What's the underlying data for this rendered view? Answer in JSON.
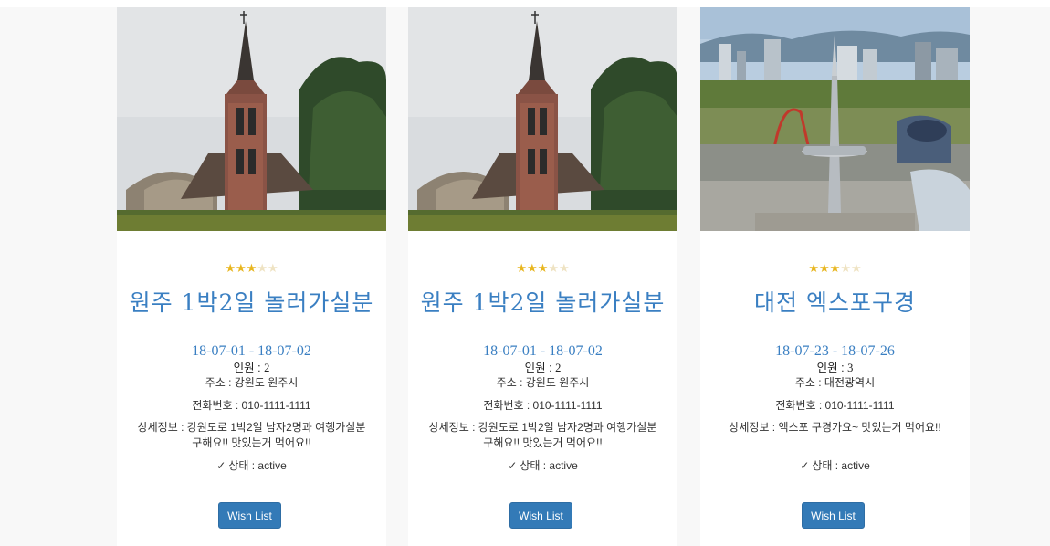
{
  "cards": [
    {
      "image": "church-photo",
      "rating": 3,
      "max_rating": 5,
      "title": "원주 1박2일 놀러가실분",
      "dates": "18-07-01 - 18-07-02",
      "people_label": "인원 : ",
      "people_value": "2",
      "address": "주소 :  강원도 원주시",
      "phone": "전화번호 :  010-1111-1111",
      "detail": "상세정보 :  강원도로 1박2일 남자2명과 여행가실분 구해요!! 맛있는거 먹어요!!",
      "status": "상태 : active",
      "button": "Wish List"
    },
    {
      "image": "church-photo",
      "rating": 3,
      "max_rating": 5,
      "title": "원주 1박2일 놀러가실분",
      "dates": "18-07-01 - 18-07-02",
      "people_label": "인원 : ",
      "people_value": "2",
      "address": "주소 :  강원도 원주시",
      "phone": "전화번호 :  010-1111-1111",
      "detail": "상세정보 :  강원도로 1박2일 남자2명과 여행가실분 구해요!! 맛있는거 먹어요!!",
      "status": "상태 : active",
      "button": "Wish List"
    },
    {
      "image": "expo-tower-photo",
      "rating": 3,
      "max_rating": 5,
      "title": "대전 엑스포구경",
      "dates": "18-07-23 - 18-07-26",
      "people_label": "인원 : ",
      "people_value": "3",
      "address": "주소 :  대전광역시",
      "phone": "전화번호 :  010-1111-1111",
      "detail": "상세정보 :  엑스포 구경가요~ 맛있는거 먹어요!!",
      "status": "상태 : active",
      "button": "Wish List"
    }
  ],
  "colors": {
    "accent": "#3a7fc2",
    "button": "#337ab7",
    "star": "#e8b620"
  },
  "icons": {
    "star": "star-icon",
    "check": "check-icon"
  }
}
